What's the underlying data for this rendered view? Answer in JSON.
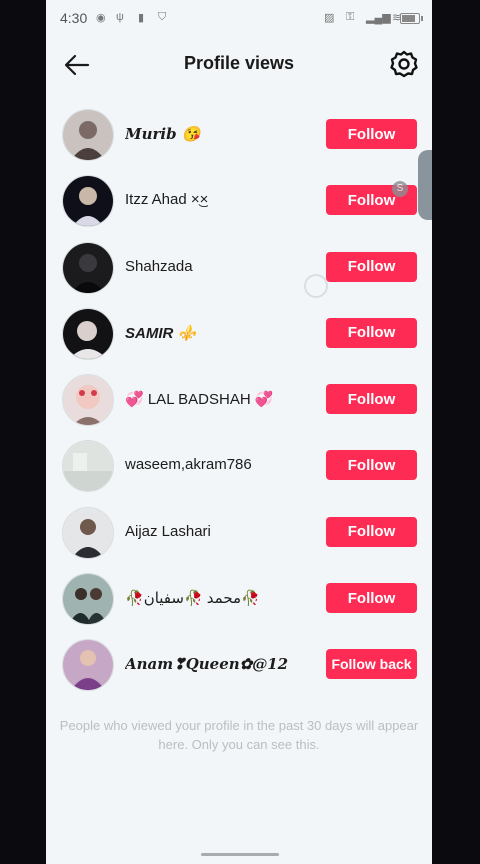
{
  "status_bar": {
    "time": "4:30",
    "icons": [
      "record-icon",
      "usb-icon",
      "sim-icon",
      "shield-icon",
      "image-icon",
      "key-icon",
      "signal-icon",
      "wifi-icon",
      "battery-icon"
    ]
  },
  "header": {
    "title": "Profile views",
    "back_icon": "arrow-left-icon",
    "settings_icon": "gear-icon"
  },
  "users": [
    {
      "name": "Murib 😘",
      "button": "Follow"
    },
    {
      "name": "Itzz Ahad ×͜×",
      "button": "Follow"
    },
    {
      "name": "Shahzada",
      "button": "Follow"
    },
    {
      "name": "SAMIR ⚜️",
      "button": "Follow"
    },
    {
      "name": "💞 LAL BADSHAH 💞",
      "button": "Follow"
    },
    {
      "name": "waseem,akram786",
      "button": "Follow"
    },
    {
      "name": "Aijaz Lashari",
      "button": "Follow"
    },
    {
      "name": "🥀محمد 🥀سفیان🥀",
      "button": "Follow"
    },
    {
      "name": "Anam❣Queen✿@12",
      "button": "Follow back"
    }
  ],
  "footer_note": "People who viewed your profile in the past 30 days will appear here. Only you can see this.",
  "overlay": {
    "badge": "S"
  },
  "colors": {
    "accent": "#fe2c55",
    "background": "#f2f6f8",
    "note": "#b9bec2"
  }
}
